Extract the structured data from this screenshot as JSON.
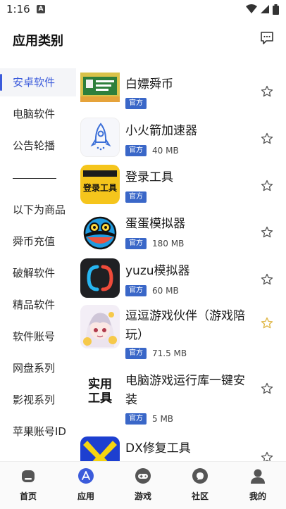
{
  "status": {
    "time": "1:16",
    "notif": "A"
  },
  "header": {
    "title": "应用类别"
  },
  "sidebar": {
    "items": [
      {
        "label": "安卓软件"
      },
      {
        "label": "电脑软件"
      },
      {
        "label": "公告轮播"
      },
      {
        "label": "以下为商品"
      },
      {
        "label": "舜币充值"
      },
      {
        "label": "破解软件"
      },
      {
        "label": "精品软件"
      },
      {
        "label": "软件账号"
      },
      {
        "label": "网盘系列"
      },
      {
        "label": "影视系列"
      },
      {
        "label": "苹果账号ID"
      }
    ],
    "divider": "————"
  },
  "apps": [
    {
      "name": "白嫖舜币",
      "badge": "官方",
      "size": "",
      "favorite": false,
      "icon": "coin-banner-icon"
    },
    {
      "name": "小火箭加速器",
      "badge": "官方",
      "size": "40 MB",
      "favorite": false,
      "icon": "rocket-icon"
    },
    {
      "name": "登录工具",
      "badge": "官方",
      "size": "",
      "favorite": false,
      "icon": "login-tool-icon",
      "icon_text": "登录工具"
    },
    {
      "name": "蛋蛋模拟器",
      "badge": "官方",
      "size": "180 MB",
      "favorite": false,
      "icon": "egg-emulator-icon"
    },
    {
      "name": "yuzu模拟器",
      "badge": "官方",
      "size": "60 MB",
      "favorite": false,
      "icon": "yuzu-icon"
    },
    {
      "name": "逗逗游戏伙伴（游戏陪玩）",
      "badge": "官方",
      "size": "71.5 MB",
      "favorite": true,
      "icon": "anime-girl-icon"
    },
    {
      "name": "电脑游戏运行库一键安装",
      "badge": "官方",
      "size": "5 MB",
      "favorite": false,
      "icon": "runtime-icon",
      "icon_text": "实用工具"
    },
    {
      "name": "DX修复工具",
      "badge": "",
      "size": "",
      "favorite": false,
      "icon": "dx-repair-icon"
    }
  ],
  "nav": [
    {
      "label": "首页",
      "icon": "home-icon",
      "active": false
    },
    {
      "label": "应用",
      "icon": "app-store-icon",
      "active": true
    },
    {
      "label": "游戏",
      "icon": "gamepad-icon",
      "active": false
    },
    {
      "label": "社区",
      "icon": "chat-bubble-icon",
      "active": false
    },
    {
      "label": "我的",
      "icon": "user-icon",
      "active": false
    }
  ],
  "colors": {
    "accent": "#3b5bdb",
    "badge": "#3a67c8",
    "star_active": "#e0b84a"
  }
}
